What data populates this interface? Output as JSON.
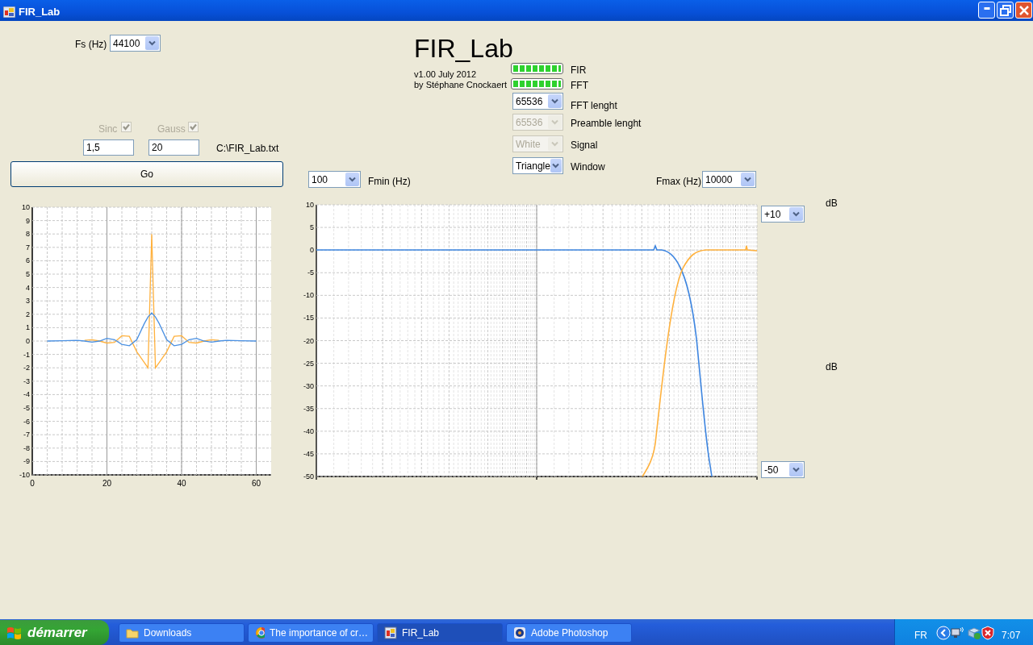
{
  "window": {
    "title": "FIR_Lab"
  },
  "sample_rate": {
    "label": "Fs (Hz)",
    "value": "44100"
  },
  "header": {
    "title": "FIR_Lab",
    "version": "v1.00 July 2012",
    "author": "by Stéphane Cnockaert"
  },
  "progress": [
    {
      "label": "FIR",
      "level": 1
    },
    {
      "label": "FFT",
      "level": 1
    }
  ],
  "settings": [
    {
      "label": "FFT lenght",
      "value": "65536",
      "disabled": false
    },
    {
      "label": "Preamble lenght",
      "value": "65536",
      "disabled": true
    },
    {
      "label": "Signal",
      "value": "White",
      "disabled": true
    },
    {
      "label": "Window",
      "value": "Triangle",
      "disabled": false
    }
  ],
  "kernel": {
    "options": [
      {
        "label": "Sinc",
        "checked": true,
        "disabled": true
      },
      {
        "label": "Gauss",
        "checked": true,
        "disabled": true
      }
    ],
    "params": [
      "1,5",
      "20"
    ],
    "file": "C:\\FIR_Lab.txt"
  },
  "go_button": "Go",
  "fmin": {
    "value": "100",
    "label": "Fmin (Hz)"
  },
  "fmax": {
    "label": "Fmax (Hz)",
    "value": "10000"
  },
  "impulse_chart": {
    "chart_data": {
      "type": "line",
      "grid": true,
      "x": [
        4,
        8,
        12,
        14,
        16,
        18,
        20,
        22,
        24,
        26,
        28,
        30,
        31,
        32,
        33,
        34,
        36,
        38,
        40,
        42,
        44,
        46,
        48,
        50,
        52,
        56,
        60
      ],
      "xlim": [
        0,
        64
      ],
      "ylim": [
        -10,
        10
      ],
      "xticks": [
        0,
        20,
        40,
        60
      ],
      "yticks": [
        -10,
        -9,
        -8,
        -7,
        -6,
        -5,
        -4,
        -3,
        -2,
        -1,
        0,
        1,
        2,
        3,
        4,
        5,
        6,
        7,
        8,
        9,
        10
      ],
      "series": [
        {
          "color": "#ffb13d",
          "values": [
            null,
            null,
            null,
            0.05,
            0.1,
            0,
            -0.15,
            -0.1,
            0.4,
            0.35,
            -0.8,
            -1.6,
            -2,
            8,
            -2,
            -1.6,
            -0.8,
            0.35,
            0.4,
            -0.1,
            -0.15,
            0,
            0.1,
            0.05,
            null,
            null,
            null
          ]
        },
        {
          "color": "#4a90e2",
          "values": [
            0,
            0.02,
            0.05,
            0,
            -0.08,
            0,
            0.2,
            0.1,
            -0.25,
            -0.35,
            0.1,
            1.3,
            1.8,
            2.1,
            1.8,
            1.3,
            0.1,
            -0.35,
            -0.25,
            0.1,
            0.2,
            0,
            -0.08,
            0,
            0.05,
            0.02,
            0
          ]
        }
      ]
    }
  },
  "response_chart": {
    "y_tick_labels": [
      "10",
      "5",
      "0",
      "-5",
      "-10",
      "-15",
      "-20",
      "-25",
      "-30",
      "-35",
      "-40",
      "-45",
      "-50"
    ],
    "top_range": "+10",
    "bottom_range": "-50",
    "units": [
      "dB",
      "dB"
    ]
  },
  "taskbar": {
    "start": "démarrer",
    "tasks": [
      {
        "label": "Downloads",
        "selected": false
      },
      {
        "label": "The importance of cr…",
        "selected": false
      },
      {
        "label": "FIR_Lab",
        "selected": true
      },
      {
        "label": "Adobe Photoshop",
        "selected": false
      }
    ],
    "language": "FR",
    "clock": "7:07"
  }
}
